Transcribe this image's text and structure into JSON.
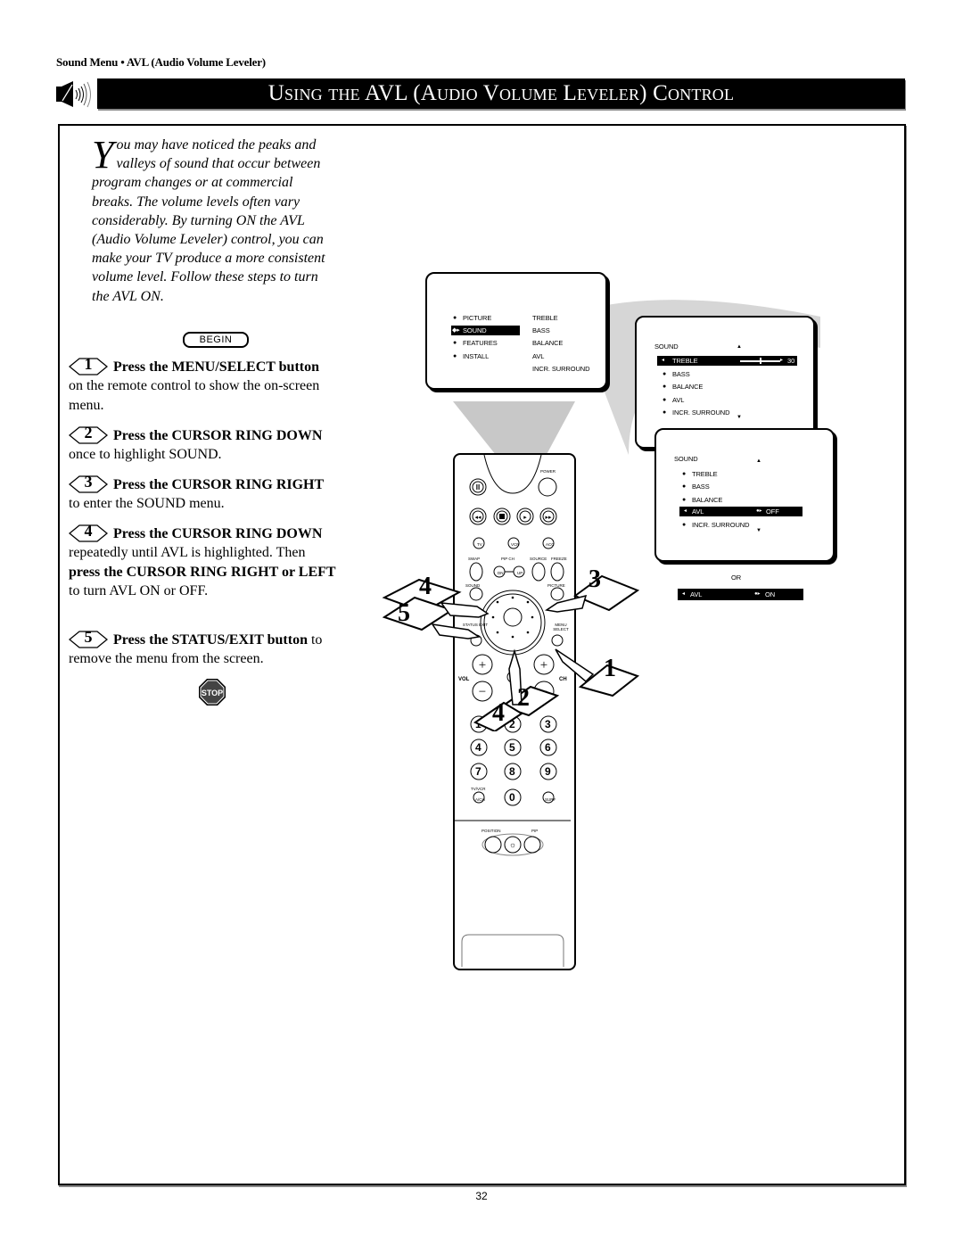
{
  "page": {
    "section_header": "Sound Menu • AVL (Audio Volume Leveler)",
    "title": "Using the AVL (Audio Volume Leveler) Control",
    "page_number": "32"
  },
  "intro": {
    "drop_cap": "Y",
    "text": "ou may have noticed the peaks and valleys of sound that occur between program changes or at commercial breaks. The volume levels often vary considerably. By turning ON the AVL (Audio Volume Leveler) control, you can make your TV produce a more consistent volume level. Follow these steps to turn the AVL ON."
  },
  "begin_label": "BEGIN",
  "steps": [
    {
      "number": "1",
      "bold": "Press the MENU/SELECT button",
      "rest": " on the remote control to show the on-screen menu."
    },
    {
      "number": "2",
      "bold": "Press the CURSOR RING DOWN",
      "rest": " once to highlight SOUND."
    },
    {
      "number": "3",
      "bold": "Press the CURSOR RING RIGHT",
      "rest": " to enter the SOUND menu."
    },
    {
      "number": "4",
      "bold": "Press the CURSOR RING DOWN",
      "rest": " repeatedly until AVL is highlighted. Then ",
      "bold2": "press the CURSOR RING RIGHT or LEFT",
      "rest2": " to turn AVL ON or OFF."
    },
    {
      "number": "5",
      "bold": "Press the STATUS/EXIT button",
      "rest": " to remove the menu from the screen."
    }
  ],
  "stop_label": "STOP",
  "main_menu": {
    "left_items": [
      "PICTURE",
      "SOUND",
      "FEATURES",
      "INSTALL"
    ],
    "selected": "SOUND",
    "right_items": [
      "TREBLE",
      "BASS",
      "BALANCE",
      "AVL",
      "INCR. SURROUND"
    ]
  },
  "sound_menu_1": {
    "title": "SOUND",
    "items": [
      "TREBLE",
      "BASS",
      "BALANCE",
      "AVL",
      "INCR. SURROUND"
    ],
    "selected": "TREBLE",
    "treble_value": "30",
    "treble_slider_fraction": 0.5
  },
  "sound_menu_2": {
    "title": "SOUND",
    "items": [
      "TREBLE",
      "BASS",
      "BALANCE",
      "AVL",
      "INCR. SURROUND"
    ],
    "selected": "AVL",
    "avl_value": "OFF"
  },
  "or_label": "OR",
  "avl_on_bar": {
    "label": "AVL",
    "value": "ON"
  },
  "remote": {
    "labels": {
      "power": "POWER",
      "tv": "TV",
      "vcr": "VCR",
      "acc": "ACC",
      "swap": "SWAP",
      "pip_ch": "PIP CH",
      "dn": "DN",
      "up": "UP",
      "source": "SOURCE",
      "freeze": "FREEZE",
      "sound": "SOUND",
      "picture": "PICTURE",
      "status_exit": "STATUS EXIT",
      "menu_select": "MENU SELECT",
      "vol": "VOL",
      "ch": "CH",
      "tvvcr": "TV/VCR",
      "ach": "A/CH",
      "surf": "SURF",
      "position": "POSITION",
      "pip": "PIP"
    },
    "digits": [
      "1",
      "2",
      "3",
      "4",
      "5",
      "6",
      "7",
      "8",
      "9",
      "0"
    ],
    "callouts": [
      "1",
      "2",
      "3",
      "4",
      "4",
      "5"
    ]
  }
}
